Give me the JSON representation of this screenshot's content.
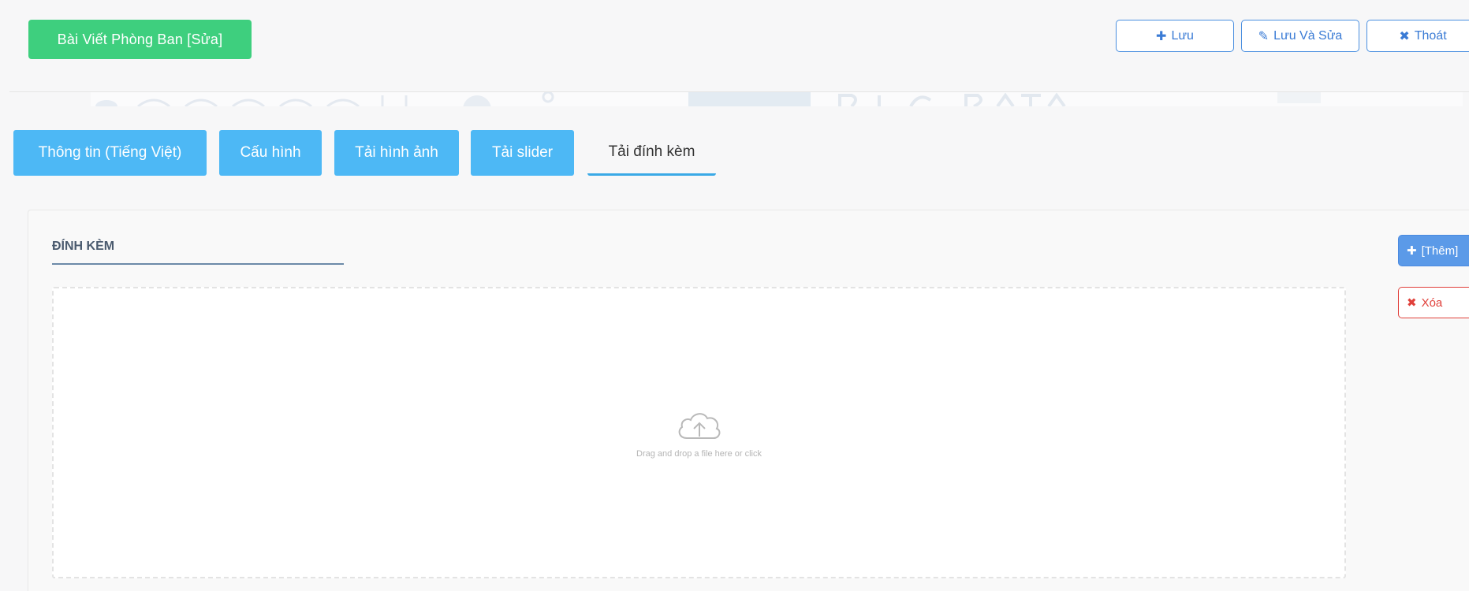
{
  "header": {
    "title": "Bài Viết Phòng Ban [Sửa]",
    "save_label": "Lưu",
    "save_edit_label": "Lưu Và Sửa",
    "exit_label": "Thoát"
  },
  "tabs": [
    {
      "label": "Thông tin (Tiếng Việt)",
      "active": false
    },
    {
      "label": "Cấu hình",
      "active": false
    },
    {
      "label": "Tải hình ảnh",
      "active": false
    },
    {
      "label": "Tải slider",
      "active": false
    },
    {
      "label": "Tải đính kèm",
      "active": true
    }
  ],
  "attachments": {
    "section_title": "ĐÍNH KÈM",
    "dropzone_text": "Drag and drop a file here or click",
    "add_label": "[Thêm]",
    "delete_label": "Xóa"
  },
  "colors": {
    "title_green": "#3ecf7e",
    "tab_blue": "#4db8f5",
    "outline_blue": "#4a8fe0",
    "delete_red": "#e0403a"
  }
}
